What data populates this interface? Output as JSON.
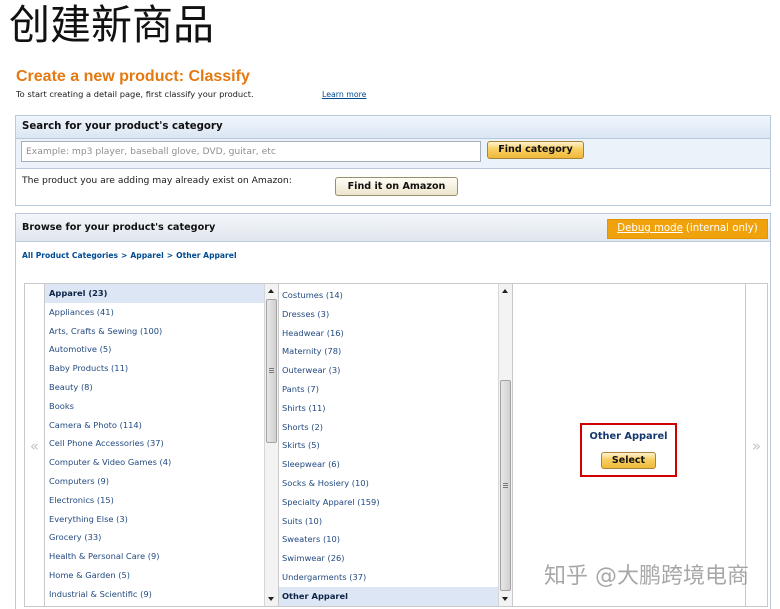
{
  "page_title_cn": "创建新商品",
  "header": {
    "title": "Create a new product: Classify",
    "subtitle": "To start creating a detail page, first classify your product.",
    "learn_more": "Learn more"
  },
  "search_panel": {
    "title": "Search for your product's category",
    "input_value": "",
    "input_placeholder": "Example: mp3 player, baseball glove, DVD, guitar, etc",
    "find_category_label": "Find category",
    "exists_text": "The product you are adding may already exist on Amazon:",
    "find_on_amazon_label": "Find it on Amazon"
  },
  "browse_panel": {
    "title": "Browse for your product's category",
    "debug": {
      "link": "Debug mode",
      "note": "(internal only)"
    },
    "breadcrumb": [
      "All Product Categories",
      "Apparel",
      "Other Apparel"
    ],
    "breadcrumb_separator": ">",
    "prev_arrow": "«",
    "next_arrow": "»",
    "columns": [
      {
        "selected_index": 0,
        "items": [
          "Apparel (23)",
          "Appliances (41)",
          "Arts, Crafts & Sewing (100)",
          "Automotive (5)",
          "Baby Products (11)",
          "Beauty (8)",
          "Books",
          "Camera & Photo (114)",
          "Cell Phone Accessories (37)",
          "Computer & Video Games (4)",
          "Computers (9)",
          "Electronics (15)",
          "Everything Else (3)",
          "Grocery (33)",
          "Health & Personal Care (9)",
          "Home & Garden (5)",
          "Industrial & Scientific (9)"
        ]
      },
      {
        "selected_index": 16,
        "items": [
          "Costumes (14)",
          "Dresses (3)",
          "Headwear (16)",
          "Maternity (78)",
          "Outerwear (3)",
          "Pants (7)",
          "Shirts (11)",
          "Shorts (2)",
          "Skirts (5)",
          "Sleepwear (6)",
          "Socks & Hosiery (10)",
          "Specialty Apparel (159)",
          "Suits (10)",
          "Sweaters (10)",
          "Swimwear (26)",
          "Undergarments (37)",
          "Other Apparel"
        ]
      }
    ],
    "selection": {
      "name": "Other Apparel",
      "select_label": "Select"
    }
  },
  "watermark": "知乎 @大鹏跨境电商",
  "icons": [
    "scroll-up-arrow-icon",
    "scroll-thumb-grip-icon",
    "scroll-down-arrow-icon"
  ],
  "colors": {
    "brand_orange": "#E47911",
    "link_blue": "#004B91",
    "item_blue": "#234A80",
    "selected_bg": "#DCE6F4",
    "debug_bg": "#F0A20C",
    "annotation_red": "#D00000",
    "panel_border": "#B9C9DA"
  }
}
